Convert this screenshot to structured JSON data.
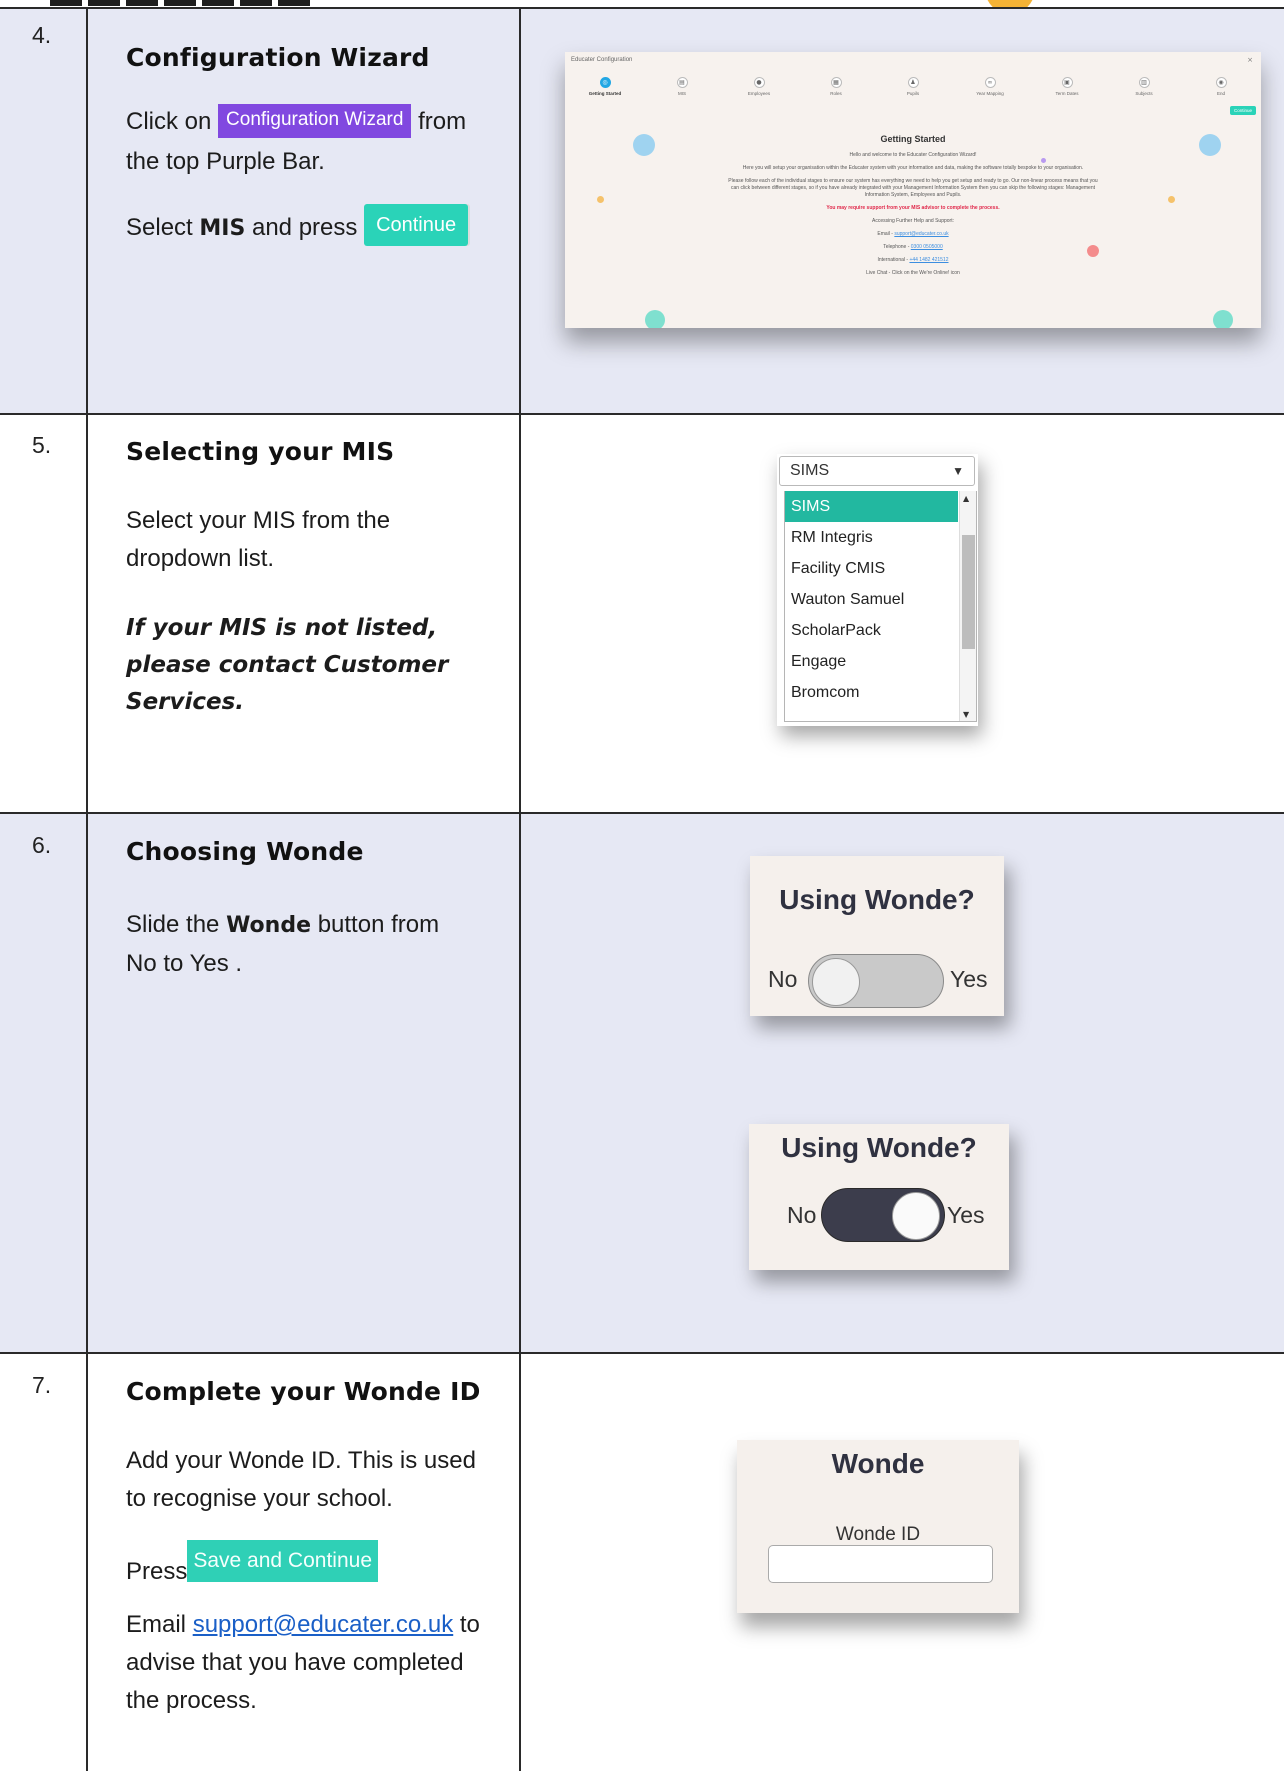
{
  "steps": [
    {
      "number": "4.",
      "heading": "Configuration Wizard",
      "click_prefix": "Click on",
      "button_label": "Configuration Wizard",
      "click_suffix": "from",
      "line2": "the top Purple Bar.",
      "select_prefix": "Select",
      "select_bold": "MIS",
      "select_mid": "and press",
      "continue_label": "Continue"
    },
    {
      "number": "5.",
      "heading": "Selecting your MIS",
      "body": "Select your MIS from the dropdown list.",
      "note": "If your MIS is not listed, please contact Customer Services."
    },
    {
      "number": "6.",
      "heading": "Choosing Wonde",
      "body_prefix": "Slide the",
      "body_bold": "Wonde",
      "body_suffix": "button from No to Yes ."
    },
    {
      "number": "7.",
      "heading": "Complete your Wonde ID",
      "body": "Add your Wonde ID. This is used to recognise your school.",
      "press_label": "Press",
      "save_label": "Save and Continue",
      "email_prefix": "Email",
      "email_link": "support@educater.co.uk",
      "email_suffix": "to advise that you have completed the process."
    }
  ],
  "wizard": {
    "window_title": "Educater Configuration",
    "close": "×",
    "steps": [
      "Getting Started",
      "MIS",
      "Employees",
      "Roles",
      "Pupils",
      "Year Mapping",
      "Term Dates",
      "Subjects",
      "End"
    ],
    "active_step": "Getting Started",
    "continue": "Continue",
    "heading": "Getting Started",
    "welcome": "Hello and welcome to the Educater Configuration Wizard!",
    "intro": "Here you will setup your organisation within the Educater system with your information and data, making the software totally bespoke to your organisation.",
    "follow": "Please follow each of the individual stages to ensure our system has everything we need to help you get setup and ready to go. Our non-linear process means that you can click between different stages, so if you have already integrated with your Management Information System then you can skip the following stages: Management Information System, Employees and Pupils.",
    "warning": "You may require support from your MIS advisor to complete the process.",
    "help": "Accessing Further Help and Support:",
    "email_label": "Email -",
    "email": "support@educater.co.uk",
    "phone_label": "Telephone -",
    "phone": "0300 0505000",
    "intl_label": "International -",
    "intl": "+44 1482 421512",
    "chat": "Live Chat - Click on the We're Online! icon"
  },
  "mis_dropdown": {
    "selected": "SIMS",
    "options": [
      "SIMS",
      "RM Integris",
      "Facility CMIS",
      "Wauton Samuel",
      "ScholarPack",
      "Engage",
      "Bromcom"
    ]
  },
  "wonde_toggle": {
    "title": "Using Wonde?",
    "no": "No",
    "yes": "Yes"
  },
  "wonde_id": {
    "title": "Wonde",
    "label": "Wonde ID",
    "value": ""
  },
  "colors": {
    "row_shade": "#e6e8f4",
    "purple_button": "#8148e0",
    "teal_button": "#2ad3b8",
    "toggle_on": "#3c3d4c",
    "toggle_off": "#c9c9c9"
  }
}
